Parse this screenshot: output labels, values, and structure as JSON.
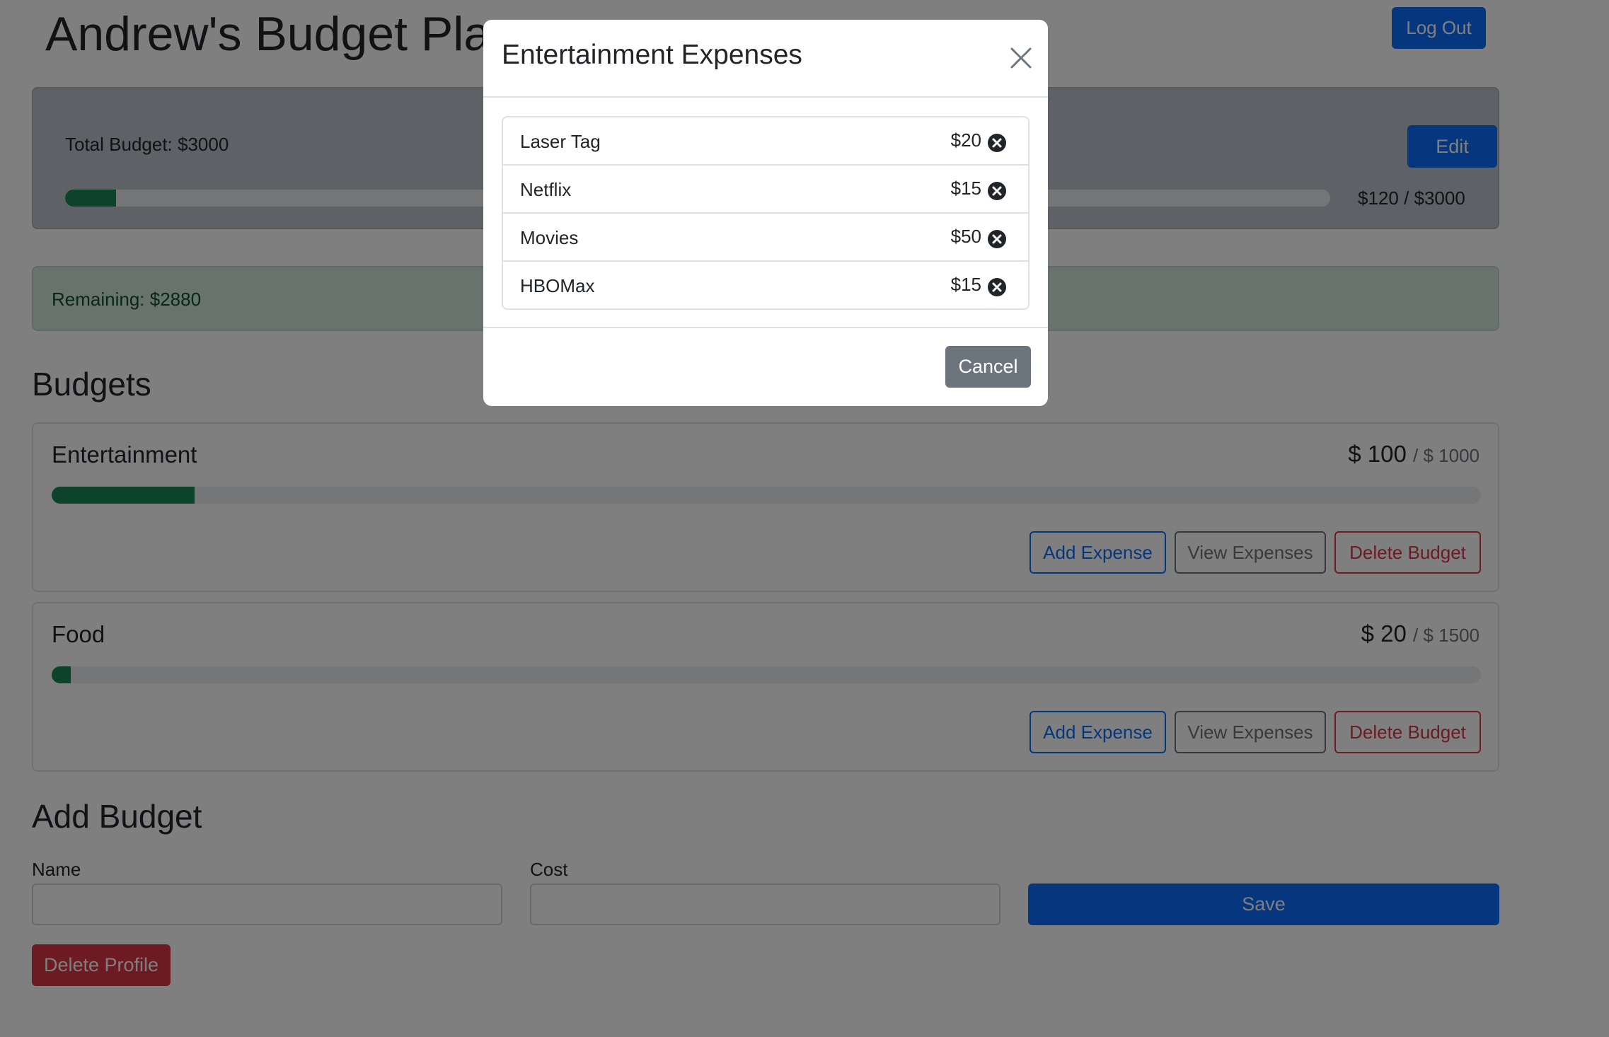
{
  "header": {
    "title": "Andrew's Budget Planner",
    "logout_label": "Log Out"
  },
  "total": {
    "label": "Total Budget: $3000",
    "edit_label": "Edit",
    "amount_text": "$120 / $3000",
    "spent": 120,
    "max": 3000
  },
  "remaining": {
    "label": "Remaining: $2880"
  },
  "budgets_heading": "Budgets",
  "budgets": [
    {
      "name": "Entertainment",
      "amount": "$ 100",
      "max": "/ $ 1000",
      "fill_percent": 10,
      "add_label": "Add Expense",
      "view_label": "View Expenses",
      "delete_label": "Delete Budget"
    },
    {
      "name": "Food",
      "amount": "$ 20",
      "max": "/ $ 1500",
      "fill_percent": 1.33,
      "add_label": "Add Expense",
      "view_label": "View Expenses",
      "delete_label": "Delete Budget"
    }
  ],
  "add_budget": {
    "heading": "Add Budget",
    "name_label": "Name",
    "cost_label": "Cost",
    "name_value": "",
    "cost_value": "",
    "save_label": "Save"
  },
  "delete_profile_label": "Delete Profile",
  "modal": {
    "title": "Entertainment Expenses",
    "close_icon": "close-icon",
    "expenses": [
      {
        "name": "Laser Tag",
        "cost": "$20"
      },
      {
        "name": "Netflix",
        "cost": "$15"
      },
      {
        "name": "Movies",
        "cost": "$50"
      },
      {
        "name": "HBOMax",
        "cost": "$15"
      }
    ],
    "cancel_label": "Cancel"
  },
  "colors": {
    "primary": "#0d6efd",
    "success": "#198754",
    "danger": "#dc3545",
    "secondary": "#6c757d"
  }
}
